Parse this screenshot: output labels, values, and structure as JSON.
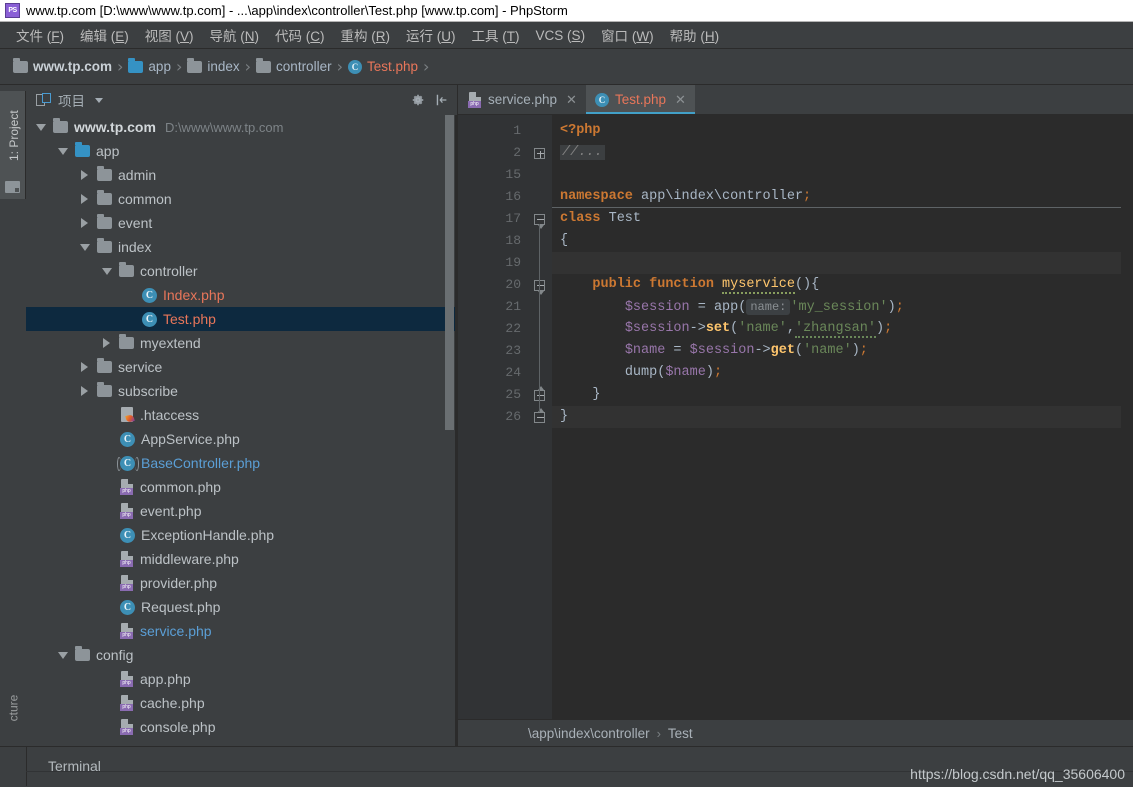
{
  "window": {
    "title": "www.tp.com [D:\\www\\www.tp.com] - ...\\app\\index\\controller\\Test.php [www.tp.com] - PhpStorm",
    "app_icon": "phpstorm-icon",
    "app_icon_text": "PS"
  },
  "menubar": {
    "items": [
      {
        "label": "文件",
        "mnemonic": "F"
      },
      {
        "label": "编辑",
        "mnemonic": "E"
      },
      {
        "label": "视图",
        "mnemonic": "V"
      },
      {
        "label": "导航",
        "mnemonic": "N"
      },
      {
        "label": "代码",
        "mnemonic": "C"
      },
      {
        "label": "重构",
        "mnemonic": "R"
      },
      {
        "label": "运行",
        "mnemonic": "U"
      },
      {
        "label": "工具",
        "mnemonic": "T"
      },
      {
        "label": "VCS",
        "mnemonic": "S"
      },
      {
        "label": "窗口",
        "mnemonic": "W"
      },
      {
        "label": "帮助",
        "mnemonic": "H"
      }
    ]
  },
  "navbar": {
    "crumbs": [
      {
        "label": "www.tp.com",
        "icon": "folder-icon",
        "style": "bold"
      },
      {
        "label": "app",
        "icon": "folder-icon-blue",
        "style": "normal"
      },
      {
        "label": "index",
        "icon": "folder-icon",
        "style": "normal"
      },
      {
        "label": "controller",
        "icon": "folder-icon",
        "style": "normal"
      },
      {
        "label": "Test.php",
        "icon": "php-class-icon",
        "style": "file"
      }
    ],
    "separator": "›"
  },
  "left_strip": {
    "project_tab": "1: Project",
    "project_tab_icon": "project-structure-icon",
    "bottom_tab": "cture"
  },
  "project_panel": {
    "title": "项目",
    "title_icon": "project-view-icon",
    "dropdown_icon": "chevron-down-icon",
    "settings_icon": "gear-icon",
    "collapse_icon": "collapse-all-icon",
    "tree": [
      {
        "depth": 0,
        "toggle": "down",
        "icon": "folder",
        "label": "www.tp.com",
        "bold": true,
        "path": "D:\\www\\www.tp.com",
        "selected": false
      },
      {
        "depth": 1,
        "toggle": "down",
        "icon": "folder-blue",
        "label": "app",
        "selected": false
      },
      {
        "depth": 2,
        "toggle": "right",
        "icon": "folder",
        "label": "admin",
        "selected": false
      },
      {
        "depth": 2,
        "toggle": "right",
        "icon": "folder",
        "label": "common",
        "selected": false
      },
      {
        "depth": 2,
        "toggle": "right",
        "icon": "folder",
        "label": "event",
        "selected": false
      },
      {
        "depth": 2,
        "toggle": "down",
        "icon": "folder",
        "label": "index",
        "selected": false
      },
      {
        "depth": 3,
        "toggle": "down",
        "icon": "folder",
        "label": "controller",
        "selected": false
      },
      {
        "depth": 4,
        "toggle": "none",
        "icon": "class",
        "label": "Index.php",
        "color": "red",
        "selected": false
      },
      {
        "depth": 4,
        "toggle": "none",
        "icon": "class",
        "label": "Test.php",
        "color": "red",
        "selected": true
      },
      {
        "depth": 3,
        "toggle": "right",
        "icon": "folder",
        "label": "myextend",
        "selected": false
      },
      {
        "depth": 2,
        "toggle": "right",
        "icon": "folder",
        "label": "service",
        "selected": false
      },
      {
        "depth": 2,
        "toggle": "right",
        "icon": "folder",
        "label": "subscribe",
        "selected": false
      },
      {
        "depth": 3,
        "toggle": "none",
        "icon": "htaccess",
        "label": ".htaccess",
        "selected": false
      },
      {
        "depth": 3,
        "toggle": "none",
        "icon": "class",
        "label": "AppService.php",
        "selected": false
      },
      {
        "depth": 3,
        "toggle": "none",
        "icon": "abstract-class",
        "label": "BaseController.php",
        "color": "blue",
        "selected": false
      },
      {
        "depth": 3,
        "toggle": "none",
        "icon": "php",
        "label": "common.php",
        "selected": false
      },
      {
        "depth": 3,
        "toggle": "none",
        "icon": "php",
        "label": "event.php",
        "selected": false
      },
      {
        "depth": 3,
        "toggle": "none",
        "icon": "class",
        "label": "ExceptionHandle.php",
        "selected": false
      },
      {
        "depth": 3,
        "toggle": "none",
        "icon": "php",
        "label": "middleware.php",
        "selected": false
      },
      {
        "depth": 3,
        "toggle": "none",
        "icon": "php",
        "label": "provider.php",
        "selected": false
      },
      {
        "depth": 3,
        "toggle": "none",
        "icon": "class",
        "label": "Request.php",
        "selected": false
      },
      {
        "depth": 3,
        "toggle": "none",
        "icon": "php",
        "label": "service.php",
        "color": "blue",
        "selected": false
      },
      {
        "depth": 1,
        "toggle": "down",
        "icon": "folder",
        "label": "config",
        "selected": false
      },
      {
        "depth": 3,
        "toggle": "none",
        "icon": "php",
        "label": "app.php",
        "selected": false
      },
      {
        "depth": 3,
        "toggle": "none",
        "icon": "php",
        "label": "cache.php",
        "selected": false
      },
      {
        "depth": 3,
        "toggle": "none",
        "icon": "php",
        "label": "console.php",
        "selected": false
      }
    ]
  },
  "editor": {
    "tabs": [
      {
        "label": "service.php",
        "icon": "php-file-icon",
        "active": false,
        "close_icon": "close-icon"
      },
      {
        "label": "Test.php",
        "icon": "php-class-icon",
        "active": true,
        "close_icon": "close-icon"
      }
    ],
    "line_numbers": [
      "1",
      "2",
      "15",
      "16",
      "17",
      "18",
      "19",
      "20",
      "21",
      "22",
      "23",
      "24",
      "25",
      "26"
    ],
    "breadcrumb": {
      "namespace": "\\app\\index\\controller",
      "separator": "›",
      "class": "Test"
    },
    "code_lines": [
      {
        "num": "1",
        "fold": "none",
        "current": false,
        "tokens": [
          {
            "t": "<?php",
            "c": "kw"
          }
        ]
      },
      {
        "num": "2",
        "fold": "plus",
        "current": false,
        "tokens": [
          {
            "t": "//...",
            "c": "fold-placeholder"
          }
        ]
      },
      {
        "num": "15",
        "fold": "none",
        "current": false,
        "tokens": []
      },
      {
        "num": "16",
        "fold": "none",
        "current": false,
        "sep": true,
        "tokens": [
          {
            "t": "namespace ",
            "c": "kw"
          },
          {
            "t": "app\\index\\controller",
            "c": "plain"
          },
          {
            "t": ";",
            "c": "semi"
          }
        ]
      },
      {
        "num": "17",
        "fold": "arrow-d",
        "current": false,
        "tokens": [
          {
            "t": "class ",
            "c": "kw"
          },
          {
            "t": "Test",
            "c": "plain"
          }
        ]
      },
      {
        "num": "18",
        "fold": "none",
        "current": false,
        "tokens": [
          {
            "t": "{",
            "c": "punc"
          }
        ]
      },
      {
        "num": "19",
        "fold": "none",
        "current": true,
        "tokens": []
      },
      {
        "num": "20",
        "fold": "arrow-d",
        "current": false,
        "tokens": [
          {
            "t": "    public function ",
            "c": "kw"
          },
          {
            "t": "myservice",
            "c": "fn warn"
          },
          {
            "t": "(){",
            "c": "punc"
          }
        ]
      },
      {
        "num": "21",
        "fold": "none",
        "current": false,
        "tokens": [
          {
            "t": "        ",
            "c": "plain"
          },
          {
            "t": "$session",
            "c": "var"
          },
          {
            "t": " = ",
            "c": "punc"
          },
          {
            "t": "app",
            "c": "plain"
          },
          {
            "t": "(",
            "c": "punc"
          },
          {
            "t": "name:",
            "c": "hint"
          },
          {
            "t": "'my_session'",
            "c": "str"
          },
          {
            "t": ")",
            "c": "punc"
          },
          {
            "t": ";",
            "c": "semi"
          }
        ]
      },
      {
        "num": "22",
        "fold": "none",
        "current": false,
        "tokens": [
          {
            "t": "        ",
            "c": "plain"
          },
          {
            "t": "$session",
            "c": "var"
          },
          {
            "t": "->",
            "c": "punc"
          },
          {
            "t": "set",
            "c": "meth"
          },
          {
            "t": "(",
            "c": "punc"
          },
          {
            "t": "'name'",
            "c": "str"
          },
          {
            "t": ",",
            "c": "punc"
          },
          {
            "t": "'zhangsan'",
            "c": "str spell"
          },
          {
            "t": ")",
            "c": "punc"
          },
          {
            "t": ";",
            "c": "semi"
          }
        ]
      },
      {
        "num": "23",
        "fold": "none",
        "current": false,
        "tokens": [
          {
            "t": "        ",
            "c": "plain"
          },
          {
            "t": "$name",
            "c": "var"
          },
          {
            "t": " = ",
            "c": "punc"
          },
          {
            "t": "$session",
            "c": "var"
          },
          {
            "t": "->",
            "c": "punc"
          },
          {
            "t": "get",
            "c": "meth"
          },
          {
            "t": "(",
            "c": "punc"
          },
          {
            "t": "'name'",
            "c": "str"
          },
          {
            "t": ")",
            "c": "punc"
          },
          {
            "t": ";",
            "c": "semi"
          }
        ]
      },
      {
        "num": "24",
        "fold": "none",
        "current": false,
        "tokens": [
          {
            "t": "        ",
            "c": "plain"
          },
          {
            "t": "dump",
            "c": "plain"
          },
          {
            "t": "(",
            "c": "punc"
          },
          {
            "t": "$name",
            "c": "var"
          },
          {
            "t": ")",
            "c": "punc"
          },
          {
            "t": ";",
            "c": "semi"
          }
        ]
      },
      {
        "num": "25",
        "fold": "arrow-u",
        "current": false,
        "tokens": [
          {
            "t": "    }",
            "c": "punc"
          }
        ]
      },
      {
        "num": "26",
        "fold": "arrow-u",
        "current": true,
        "tokens": [
          {
            "t": "}",
            "c": "punc"
          }
        ]
      }
    ]
  },
  "statusbar": {
    "terminal_label": "Terminal",
    "watermark": "https://blog.csdn.net/qq_35606400"
  },
  "colors": {
    "accent_blue": "#3592c4",
    "tab_underline": "#42a0c8",
    "file_red": "#e8765a",
    "keyword_orange": "#cc7832",
    "string_green": "#6a8759",
    "variable_purple": "#9876aa",
    "method_yellow": "#ffc66d",
    "panel_bg": "#3c3f41",
    "editor_bg": "#2b2b2b",
    "selection_navy": "#0d293f"
  }
}
